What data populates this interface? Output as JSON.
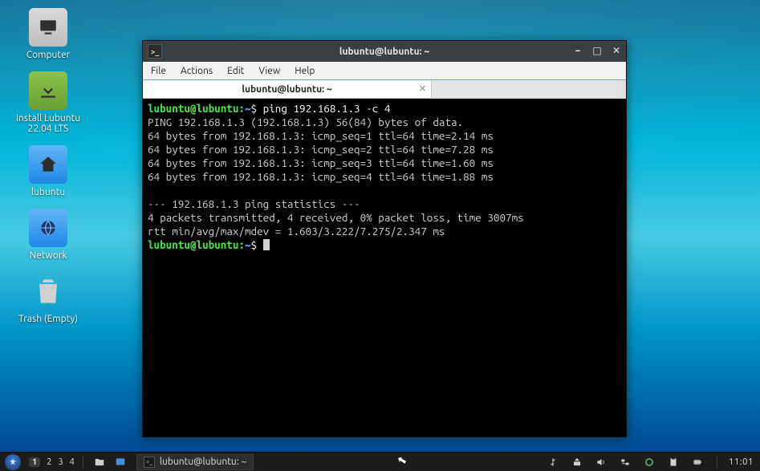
{
  "desktop_icons": {
    "computer": {
      "label": "Computer"
    },
    "install": {
      "label": "Install Lubuntu 22.04 LTS"
    },
    "home": {
      "label": "lubuntu"
    },
    "network": {
      "label": "Network"
    },
    "trash": {
      "label": "Trash (Empty)"
    }
  },
  "window": {
    "title": "lubuntu@lubuntu: ~",
    "menu": {
      "file": "File",
      "actions": "Actions",
      "edit": "Edit",
      "view": "View",
      "help": "Help"
    },
    "tab": {
      "label": "lubuntu@lubuntu: ~"
    }
  },
  "terminal": {
    "prompt_user": "lubuntu@lubuntu",
    "prompt_sep": ":",
    "prompt_path": "~",
    "prompt_end": "$",
    "command1": "ping 192.168.1.3 -c 4",
    "out1": "PING 192.168.1.3 (192.168.1.3) 56(84) bytes of data.",
    "out2": "64 bytes from 192.168.1.3: icmp_seq=1 ttl=64 time=2.14 ms",
    "out3": "64 bytes from 192.168.1.3: icmp_seq=2 ttl=64 time=7.28 ms",
    "out4": "64 bytes from 192.168.1.3: icmp_seq=3 ttl=64 time=1.60 ms",
    "out5": "64 bytes from 192.168.1.3: icmp_seq=4 ttl=64 time=1.88 ms",
    "blank": "",
    "stat1": "--- 192.168.1.3 ping statistics ---",
    "stat2": "4 packets transmitted, 4 received, 0% packet loss, time 3007ms",
    "stat3": "rtt min/avg/max/mdev = 1.603/3.222/7.275/2.347 ms"
  },
  "taskbar": {
    "desktops": {
      "d1": "1",
      "d2": "2",
      "d3": "3",
      "d4": "4"
    },
    "task_title": "lubuntu@lubuntu: ~",
    "clock": "11:01"
  }
}
